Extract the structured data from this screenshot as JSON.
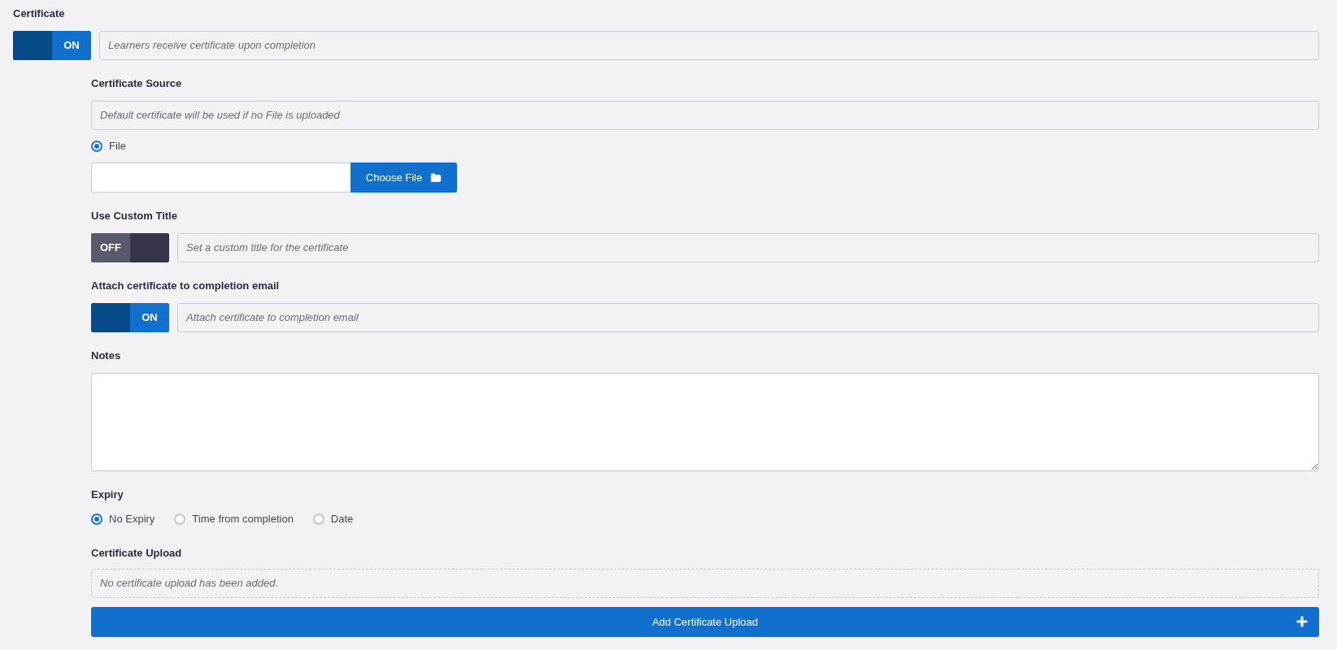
{
  "certificate": {
    "label": "Certificate",
    "toggle": {
      "on": true,
      "text": "ON"
    },
    "description": "Learners receive certificate upon completion"
  },
  "certificate_source": {
    "label": "Certificate Source",
    "description": "Default certificate will be used if no File is uploaded",
    "options": [
      {
        "label": "File",
        "selected": true
      }
    ],
    "file_field": {
      "button": "Choose File"
    }
  },
  "use_custom_title": {
    "label": "Use Custom Title",
    "toggle": {
      "on": false,
      "text": "OFF"
    },
    "description": "Set a custom title for the certificate"
  },
  "attach_to_email": {
    "label": "Attach certificate to completion email",
    "toggle": {
      "on": true,
      "text": "ON"
    },
    "description": "Attach certificate to completion email"
  },
  "notes": {
    "label": "Notes"
  },
  "expiry": {
    "label": "Expiry",
    "options": [
      {
        "label": "No Expiry",
        "selected": true
      },
      {
        "label": "Time from completion",
        "selected": false
      },
      {
        "label": "Date",
        "selected": false
      }
    ]
  },
  "certificate_upload": {
    "label": "Certificate Upload",
    "empty_message": "No certificate upload has been added.",
    "add_button": "Add Certificate Upload"
  }
}
